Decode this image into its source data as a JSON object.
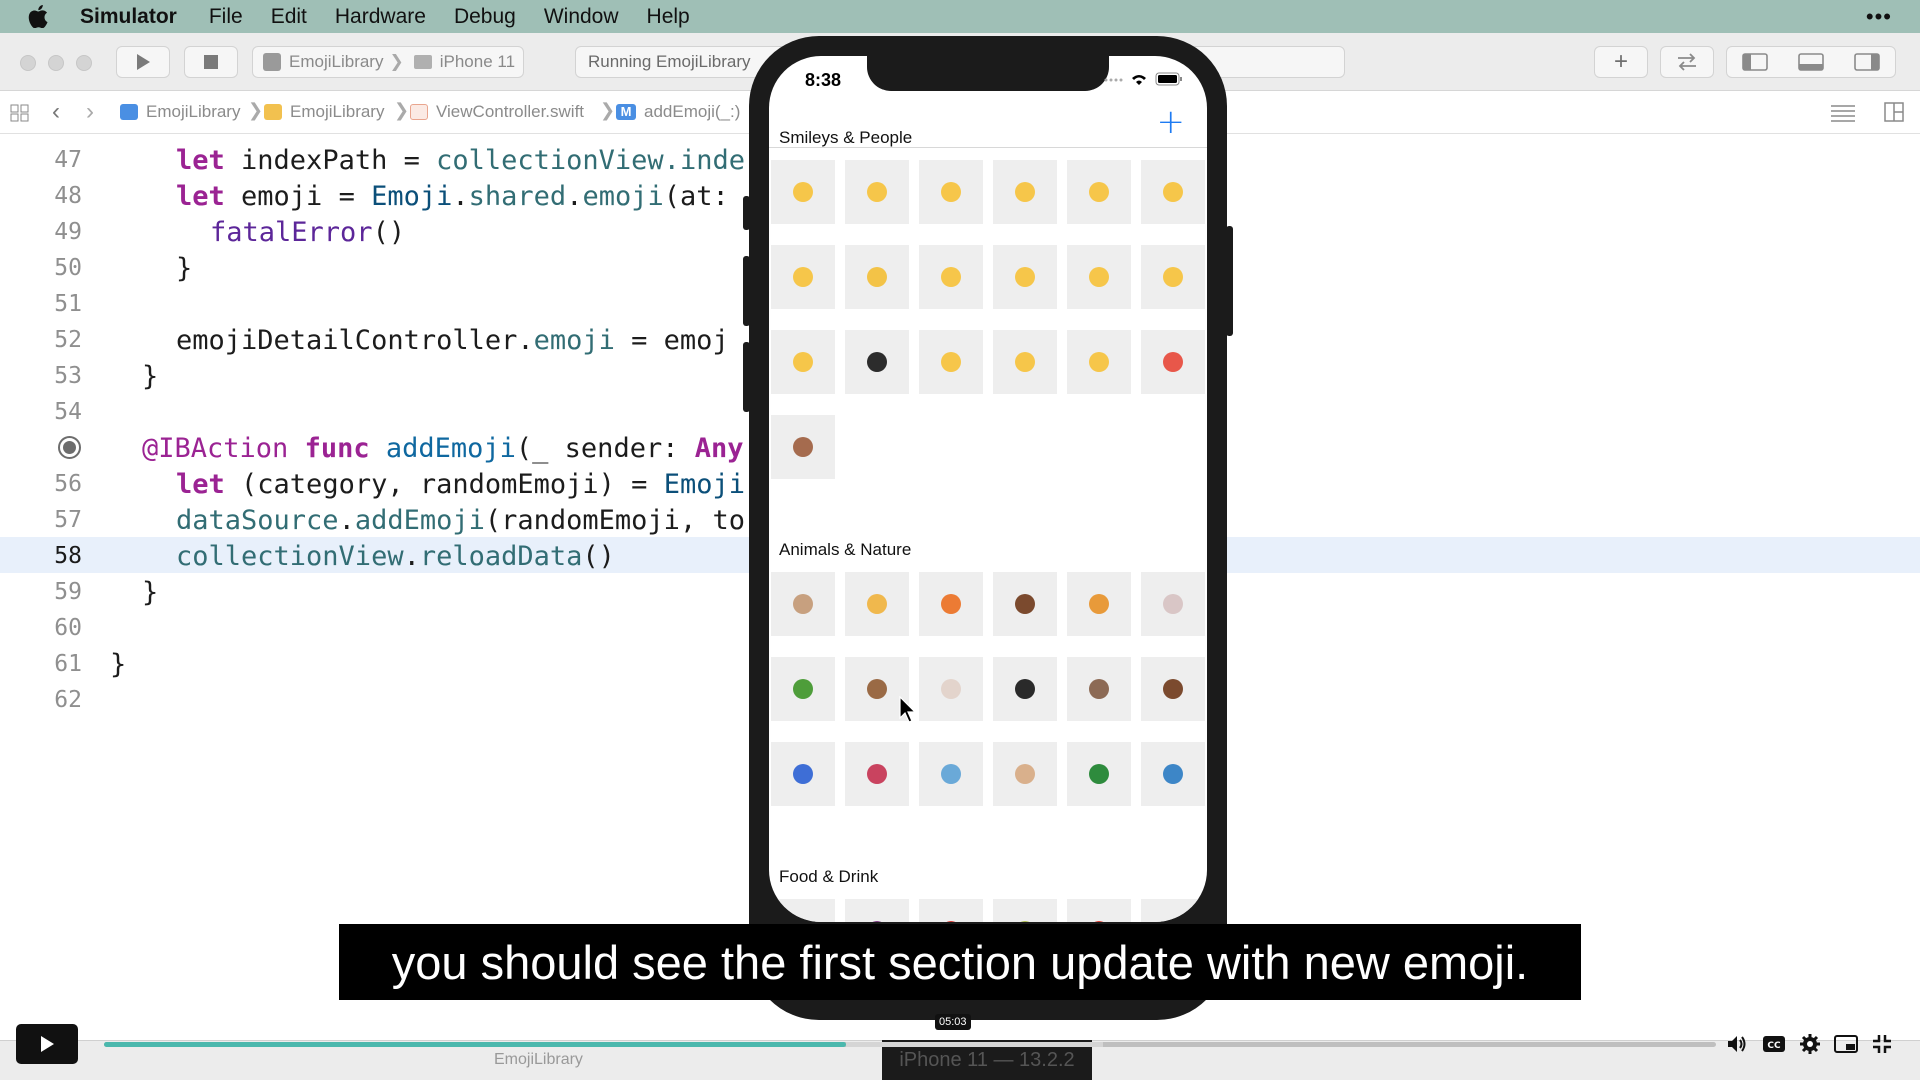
{
  "menubar": {
    "app_name": "Simulator",
    "items": [
      "File",
      "Edit",
      "Hardware",
      "Debug",
      "Window",
      "Help"
    ],
    "more": "•••"
  },
  "toolbar": {
    "scheme_target": "EmojiLibrary",
    "scheme_device": "iPhone 11",
    "activity_status": "Running EmojiLibrary",
    "add_icon": "plus-icon",
    "swap_icon": "arrows-icon"
  },
  "jumpbar": {
    "crumbs": [
      "EmojiLibrary",
      "EmojiLibrary",
      "ViewController.swift",
      "addEmoji(_:)"
    ],
    "method_badge": "M"
  },
  "editor": {
    "current_line": "58",
    "lines": [
      {
        "num": "47",
        "code": "let indexPath = collectionView.inde"
      },
      {
        "num": "48",
        "code": "let emoji = Emoji.shared.emoji(at:"
      },
      {
        "num": "49",
        "code": "fatalError()"
      },
      {
        "num": "50",
        "code": "}"
      },
      {
        "num": "51",
        "code": ""
      },
      {
        "num": "52",
        "code": "emojiDetailController.emoji = emoj"
      },
      {
        "num": "53",
        "code": "}"
      },
      {
        "num": "54",
        "code": ""
      },
      {
        "num": "55",
        "code": "@IBAction func addEmoji(_ sender: Any"
      },
      {
        "num": "56",
        "code": "let (category, randomEmoji) = Emoji"
      },
      {
        "num": "57",
        "code": "dataSource.addEmoji(randomEmoji, to"
      },
      {
        "num": "58",
        "code": "collectionView.reloadData()"
      },
      {
        "num": "59",
        "code": "}"
      },
      {
        "num": "60",
        "code": ""
      },
      {
        "num": "61",
        "code": "}"
      },
      {
        "num": "62",
        "code": ""
      }
    ],
    "tokens": {
      "l47": {
        "kw": "let",
        "plain1": " indexPath = ",
        "fn": "collectionView.inde"
      },
      "l48": {
        "kw": "let",
        "plain1": " emoji = ",
        "ty": "Emoji",
        "plain2": ".",
        "fn1": "shared",
        "plain3": ".",
        "fn2": "emoji",
        "plain4": "(at:"
      },
      "l49": {
        "fn": "fatalError",
        "plain": "()"
      },
      "l52": {
        "plain1": "emojiDetailController.",
        "fn": "emoji",
        "plain2": " = emoj"
      },
      "l55": {
        "at": "@IBAction",
        "kw": " func ",
        "fn": "addEmoji",
        "plain": "(_ sender: ",
        "ty": "Any"
      },
      "l56": {
        "kw": "let",
        "plain": " (category, randomEmoji) = ",
        "ty": "Emoji"
      },
      "l57": {
        "fn1": "dataSource",
        "plain1": ".",
        "fn2": "addEmoji",
        "plain2": "(randomEmoji, to"
      },
      "l58": {
        "fn1": "collectionView",
        "plain1": ".",
        "fn2": "reloadData",
        "plain2": "()"
      }
    }
  },
  "simulator": {
    "device_label": "iPhone 11 — 13.2.2",
    "time": "8:38",
    "nav_add": "+",
    "sections": [
      {
        "title": "Smileys & People",
        "colors": [
          "#f6c64a",
          "#f6c64a",
          "#f6c64a",
          "#f6c64a",
          "#f6c64a",
          "#f6c64a",
          "#f6c64a",
          "#f3c347",
          "#f6c64a",
          "#f6c64a",
          "#f6c64a",
          "#f6c64a",
          "#f6c64a",
          "#2c2c2c",
          "#f6c64a",
          "#f6c64a",
          "#f6c64a",
          "#e8574a",
          "#a56b4e"
        ]
      },
      {
        "title": "Animals & Nature",
        "colors": [
          "#c7a07f",
          "#f0b84d",
          "#ec7b34",
          "#7b4a2e",
          "#e89a3a",
          "#d9c6c6",
          "#4e9d3a",
          "#9a6a45",
          "#e3d4cc",
          "#2a2a2a",
          "#8c6a55",
          "#7b4a2e",
          "#3e6ed6",
          "#c9435f",
          "#6aa9d8",
          "#d9b08c",
          "#2e8b3d",
          "#3d86c7"
        ]
      },
      {
        "title": "Food & Drink",
        "colors": [
          "#5fb43a",
          "#7b3a80",
          "#d2352f",
          "#a9b94a",
          "#d8392e",
          "#e4b73a"
        ]
      }
    ]
  },
  "video": {
    "caption": "you should see the first section update with new emoji.",
    "timestamp": "05:03",
    "progress_played": 0.46,
    "progress_buffered": 0.62
  },
  "debugbar": {
    "target": "EmojiLibrary"
  }
}
